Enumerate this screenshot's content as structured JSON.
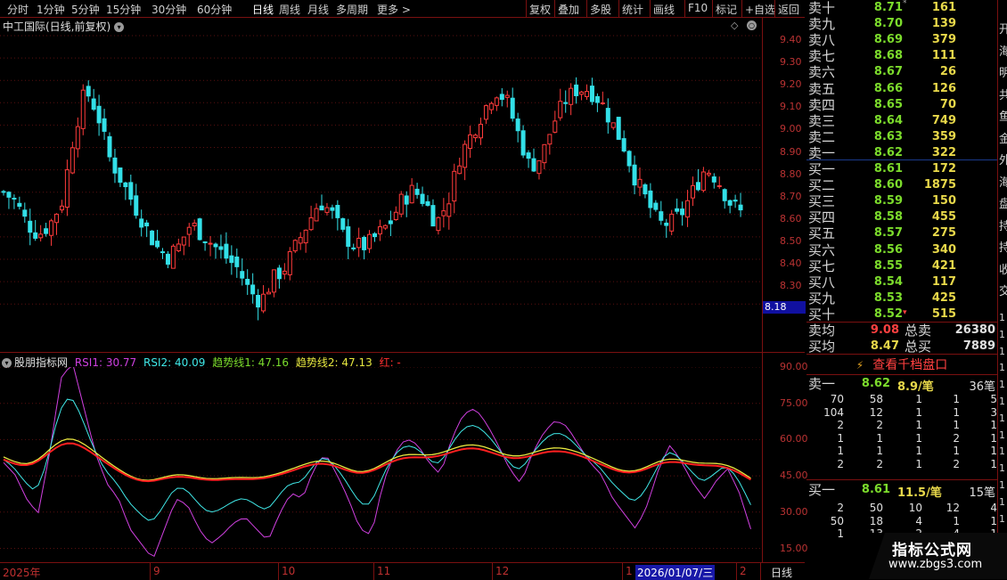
{
  "toolbar": {
    "periods": [
      "分时",
      "1分钟",
      "5分钟",
      "15分钟",
      "30分钟",
      "60分钟",
      "日线",
      "周线",
      "月线",
      "多周期",
      "更多 >"
    ],
    "active": "日线",
    "actions": [
      "复权",
      "叠加",
      "多股",
      "统计",
      "画线",
      "F10",
      "标记",
      "+自选",
      "返回"
    ]
  },
  "title": "中工国际(日线,前复权)",
  "price_axis": [
    "9.40",
    "9.30",
    "9.20",
    "9.10",
    "9.00",
    "8.90",
    "8.80",
    "8.70",
    "8.60",
    "8.50",
    "8.40",
    "8.30"
  ],
  "price_marker": "8.18",
  "indicator": {
    "name": "股朋指标网",
    "rsi1": "RSI1: 30.77",
    "rsi2": "RSI2: 40.09",
    "trend1": "趋势线1: 47.16",
    "trend2": "趋势线2: 47.13",
    "red": "红: -",
    "axis": [
      "90.00",
      "75.00",
      "60.00",
      "45.00",
      "30.00",
      "15.00"
    ]
  },
  "xaxis": {
    "labels": [
      "2025年",
      "9",
      "10",
      "11",
      "12",
      "1",
      "2026/01/07/三",
      "2"
    ],
    "period": "日线"
  },
  "colors": {
    "up": "#ff3b3b",
    "down": "#33e0e8",
    "rsi1": "#d040e0",
    "rsi2": "#40e8e8",
    "trend1": "#e8e840",
    "trend2": "#ff2020"
  },
  "quote": {
    "sell": [
      {
        "label": "卖十",
        "price": "8.71",
        "vol": "161",
        "mark": "*"
      },
      {
        "label": "卖九",
        "price": "8.70",
        "vol": "139"
      },
      {
        "label": "卖八",
        "price": "8.69",
        "vol": "379"
      },
      {
        "label": "卖七",
        "price": "8.68",
        "vol": "111"
      },
      {
        "label": "卖六",
        "price": "8.67",
        "vol": "26"
      },
      {
        "label": "卖五",
        "price": "8.66",
        "vol": "126"
      },
      {
        "label": "卖四",
        "price": "8.65",
        "vol": "70"
      },
      {
        "label": "卖三",
        "price": "8.64",
        "vol": "749"
      },
      {
        "label": "卖二",
        "price": "8.63",
        "vol": "359"
      },
      {
        "label": "卖一",
        "price": "8.62",
        "vol": "322"
      }
    ],
    "buy": [
      {
        "label": "买一",
        "price": "8.61",
        "vol": "172"
      },
      {
        "label": "买二",
        "price": "8.60",
        "vol": "1875"
      },
      {
        "label": "买三",
        "price": "8.59",
        "vol": "150"
      },
      {
        "label": "买四",
        "price": "8.58",
        "vol": "455"
      },
      {
        "label": "买五",
        "price": "8.57",
        "vol": "275"
      },
      {
        "label": "买六",
        "price": "8.56",
        "vol": "340"
      },
      {
        "label": "买七",
        "price": "8.55",
        "vol": "421"
      },
      {
        "label": "买八",
        "price": "8.54",
        "vol": "117"
      },
      {
        "label": "买九",
        "price": "8.53",
        "vol": "425"
      },
      {
        "label": "买十",
        "price": "8.52",
        "vol": "515",
        "mark": "▾"
      }
    ],
    "avg_sell": {
      "label": "卖均",
      "price": "9.08",
      "total_label": "总卖",
      "total": "26380"
    },
    "avg_buy": {
      "label": "买均",
      "price": "8.47",
      "total_label": "总买",
      "total": "7889"
    },
    "thousand_btn": "查看千档盘口",
    "sell1": {
      "label": "卖一",
      "price": "8.62",
      "per": "8.9/笔",
      "count": "36笔"
    },
    "sell1_rows": [
      [
        "70",
        "58",
        "1",
        "1",
        "5"
      ],
      [
        "104",
        "12",
        "1",
        "1",
        "3"
      ],
      [
        "2",
        "2",
        "1",
        "1",
        "1"
      ],
      [
        "1",
        "1",
        "1",
        "2",
        "1"
      ],
      [
        "1",
        "1",
        "1",
        "1",
        "1"
      ],
      [
        "2",
        "2",
        "1",
        "2",
        "1"
      ]
    ],
    "buy1": {
      "label": "买一",
      "price": "8.61",
      "per": "11.5/笔",
      "count": "15笔"
    },
    "buy1_rows": [
      [
        "2",
        "50",
        "10",
        "12",
        "4"
      ],
      [
        "50",
        "18",
        "4",
        "1",
        "1"
      ],
      [
        "1",
        "13",
        "2",
        "4",
        "1"
      ]
    ]
  },
  "edge_chars": [
    "开",
    "海",
    "明",
    "共",
    "鱼",
    "金",
    "外",
    "海",
    "盘",
    "持",
    "持",
    "收",
    "交",
    "1",
    "1",
    "1",
    "1",
    "1",
    "1",
    "1",
    "1",
    "1",
    "1",
    "1",
    "1",
    "1"
  ],
  "watermark": {
    "title": "指标公式网",
    "url": "www.zbgs3.com"
  }
}
